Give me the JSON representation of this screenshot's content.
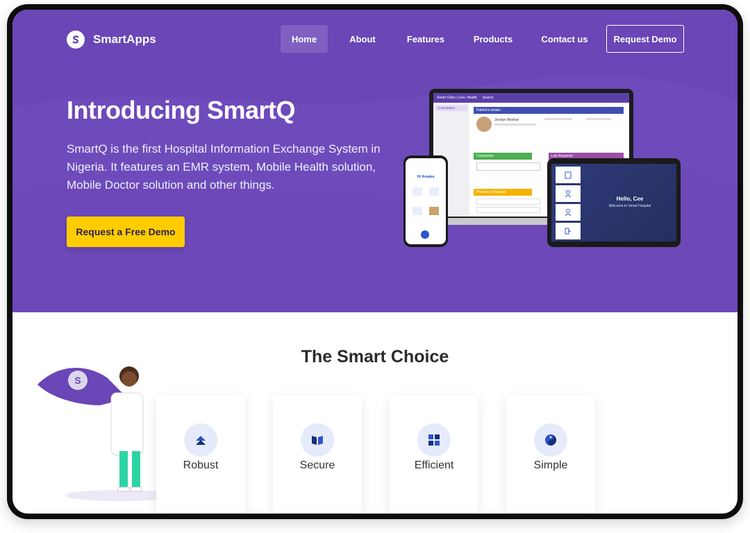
{
  "nav": {
    "brand": "SmartApps",
    "items": [
      {
        "label": "Home",
        "active": true
      },
      {
        "label": "About",
        "active": false
      },
      {
        "label": "Features",
        "active": false
      },
      {
        "label": "Products",
        "active": false
      },
      {
        "label": "Contact us",
        "active": false
      }
    ],
    "demo_label": "Request Demo"
  },
  "hero": {
    "title_prefix": "Introducing ",
    "title_brand": "SmartQ",
    "description": "SmartQ is the first Hospital Information Exchange System in Nigeria. It features an EMR system, Mobile Health solution, Mobile Doctor solution and other things.",
    "cta_label": "Request a Free Demo"
  },
  "mockups": {
    "laptop": {
      "topbar_left": "Smart Clinic | Gen. Health",
      "topbar_search": "Search",
      "side_item": "Consultation",
      "panel_patient": "Patient's details",
      "patient_name": "Jocelyn Beshue",
      "panel_complaints": "Complaints",
      "panel_lab": "Lab Requests",
      "panel_pharmacy": "Pharmacy Request"
    },
    "phone": {
      "greeting": "Hi Amaka"
    },
    "tablet": {
      "greeting": "Hello, Cee",
      "subtitle": "Welcome to Smart Hospital"
    }
  },
  "features": {
    "title": "The Smart Choice",
    "cards": [
      {
        "label": "Robust",
        "icon": "chevron-up-icon"
      },
      {
        "label": "Secure",
        "icon": "book-icon"
      },
      {
        "label": "Efficient",
        "icon": "grid-icon"
      },
      {
        "label": "Simple",
        "icon": "yin-yang-icon"
      }
    ]
  },
  "colors": {
    "primary": "#6a46b6",
    "cta": "#ffcc00",
    "icon_accent": "#2c55c8"
  }
}
